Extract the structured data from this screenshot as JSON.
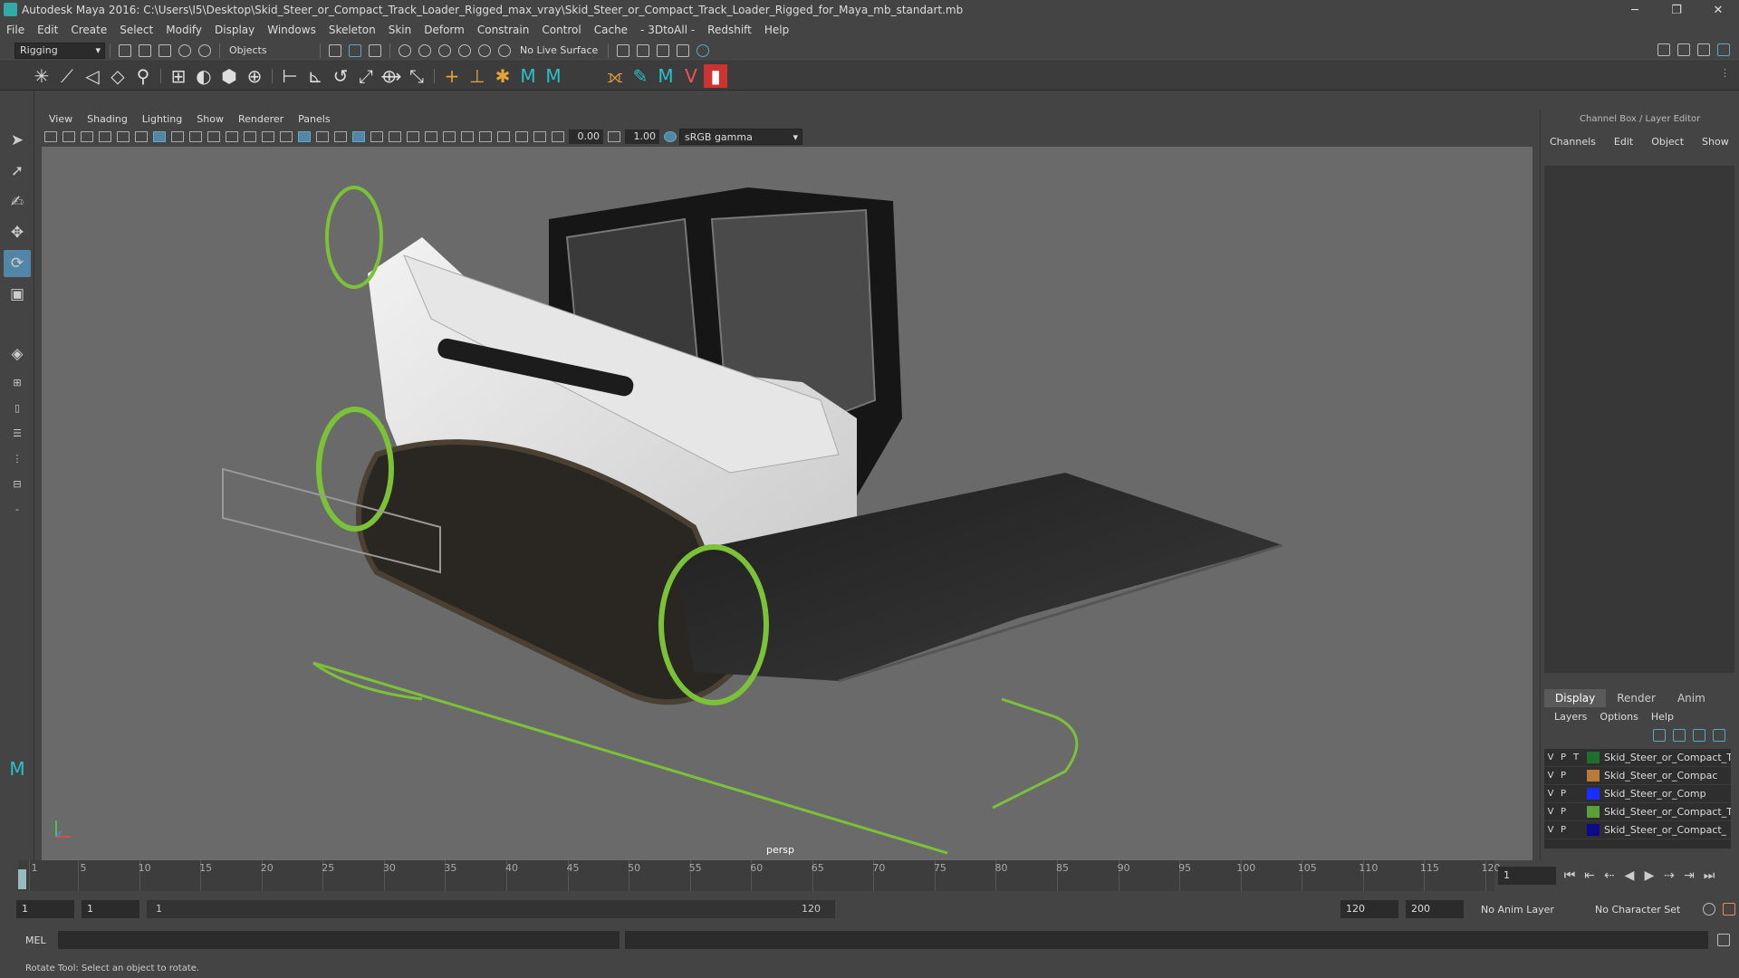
{
  "titlebar": {
    "title": "Autodesk Maya 2016: C:\\Users\\I5\\Desktop\\Skid_Steer_or_Compact_Track_Loader_Rigged_max_vray\\Skid_Steer_or_Compact_Track_Loader_Rigged_for_Maya_mb_standart.mb"
  },
  "menubar": [
    "File",
    "Edit",
    "Create",
    "Select",
    "Modify",
    "Display",
    "Windows",
    "Skeleton",
    "Skin",
    "Deform",
    "Constrain",
    "Control",
    "Cache",
    "- 3DtoAll -",
    "Redshift",
    "Help"
  ],
  "statusline": {
    "mode": "Rigging",
    "selection": "Objects",
    "live_surface": "No Live Surface"
  },
  "viewport": {
    "menu": [
      "View",
      "Shading",
      "Lighting",
      "Show",
      "Renderer",
      "Panels"
    ],
    "exposure": "0.00",
    "gamma": "1.00",
    "colorspace": "sRGB gamma",
    "camera": "persp"
  },
  "rightpanel": {
    "title": "Channel Box / Layer Editor",
    "menu": [
      "Channels",
      "Edit",
      "Object",
      "Show"
    ],
    "tabs": [
      "Display",
      "Render",
      "Anim"
    ],
    "layer_menu": [
      "Layers",
      "Options",
      "Help"
    ],
    "layers": [
      {
        "v": "V",
        "p": "P",
        "t": "T",
        "color": "#1f6e2c",
        "name": "Skid_Steer_or_Compact_Tr"
      },
      {
        "v": "V",
        "p": "P",
        "t": "",
        "color": "#b87a3a",
        "name": "Skid_Steer_or_Compac"
      },
      {
        "v": "V",
        "p": "P",
        "t": "",
        "color": "#1a2cff",
        "name": "Skid_Steer_or_Comp"
      },
      {
        "v": "V",
        "p": "P",
        "t": "",
        "color": "#5aa03a",
        "name": "Skid_Steer_or_Compact_Tr"
      },
      {
        "v": "V",
        "p": "P",
        "t": "",
        "color": "#0a0a8a",
        "name": "Skid_Steer_or_Compact_"
      }
    ]
  },
  "timeline": {
    "ticks": [
      "1",
      "5",
      "10",
      "15",
      "20",
      "25",
      "30",
      "35",
      "40",
      "45",
      "50",
      "55",
      "60",
      "65",
      "70",
      "75",
      "80",
      "85",
      "90",
      "95",
      "100",
      "105",
      "110",
      "115",
      "120"
    ],
    "current_frame": "1"
  },
  "range": {
    "start": "1",
    "playback_start": "1",
    "range_start": "1",
    "range_end": "120",
    "playback_end": "120",
    "end": "200",
    "anim_layer": "No Anim Layer",
    "char_set": "No Character Set"
  },
  "cmdline": {
    "label": "MEL"
  },
  "helpline": {
    "text": "Rotate Tool: Select an object to rotate."
  }
}
